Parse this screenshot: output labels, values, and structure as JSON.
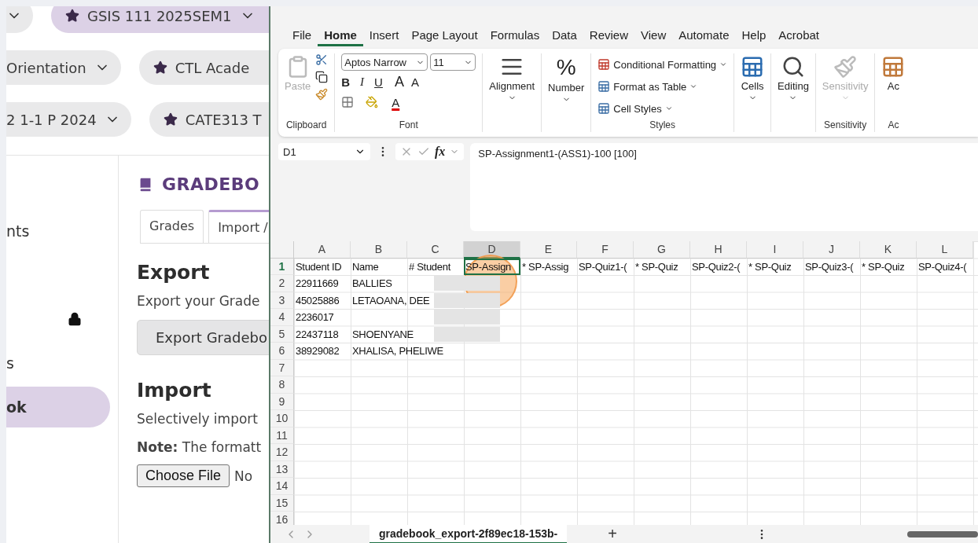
{
  "web_page": {
    "course_pills": [
      [
        {
          "starred": false,
          "selected": false,
          "chevron": true
        },
        {
          "label": "GSIS 111 2025SEM1",
          "starred": true,
          "selected": true,
          "chevron": true
        }
      ],
      [
        {
          "label": "Orientation",
          "starred": false,
          "selected": false,
          "chevron": true
        },
        {
          "label": "CTL Acade",
          "starred": true,
          "selected": false,
          "chevron": false
        }
      ],
      [
        {
          "label": "2 1-1 P 2024",
          "starred": false,
          "selected": false,
          "chevron": true
        },
        {
          "label": "CATE313 T",
          "starred": true,
          "selected": false,
          "chevron": false
        }
      ]
    ],
    "sidebar": {
      "items": [
        {
          "label": "nts",
          "locked": false,
          "selected": false
        },
        {
          "locked": true,
          "selected": false
        },
        {
          "label": "s",
          "locked": false,
          "selected": false
        },
        {
          "label": "ok",
          "locked": false,
          "selected": true
        }
      ]
    },
    "title": "GRADEBO",
    "tabs": [
      {
        "label": "Grades",
        "selected": false
      },
      {
        "label": "Import /",
        "selected": true
      }
    ],
    "export": {
      "heading": "Export",
      "text": "Export your Grade",
      "button": "Export Gradebo"
    },
    "import": {
      "heading": "Import",
      "text": "Selectively import",
      "note": "**Note:** The formatt",
      "file_button": "Choose File",
      "file_status": "No"
    }
  },
  "excel": {
    "menu": [
      {
        "label": "File",
        "selected": false
      },
      {
        "label": "Home",
        "selected": true
      },
      {
        "label": "Insert",
        "selected": false
      },
      {
        "label": "Page Layout",
        "selected": false
      },
      {
        "label": "Formulas",
        "selected": false
      },
      {
        "label": "Data",
        "selected": false
      },
      {
        "label": "Review",
        "selected": false
      },
      {
        "label": "View",
        "selected": false
      },
      {
        "label": "Automate",
        "selected": false
      },
      {
        "label": "Help",
        "selected": false
      },
      {
        "label": "Acrobat",
        "selected": false
      }
    ],
    "ribbon": {
      "clipboard": {
        "label": "Clipboard",
        "paste": "Paste",
        "paste_disabled": true
      },
      "font": {
        "label": "Font",
        "name": "Aptos Narrow",
        "size": "11",
        "bold": "B",
        "italic": "I",
        "underline": "U",
        "grow": "A",
        "shrink": "A",
        "color_letter": "A"
      },
      "alignment": "Alignment",
      "number": {
        "label": "Number",
        "symbol": "%"
      },
      "styles": {
        "label": "Styles",
        "items": [
          "Conditional Formatting",
          "Format as Table",
          "Cell Styles"
        ]
      },
      "cells": "Cells",
      "editing": "Editing",
      "sensitivity": {
        "button": "Sensitivity",
        "label": "Sensitivity",
        "disabled": true
      },
      "addins": {
        "button": "Ac",
        "label": "Ac"
      }
    },
    "formula_bar": {
      "name_box": "D1",
      "fx": "fx",
      "formula": "SP-Assignment1-(ASS1)-100 [100]"
    },
    "columns": [
      {
        "letter": "A",
        "selected": false
      },
      {
        "letter": "B",
        "selected": false
      },
      {
        "letter": "C",
        "selected": false
      },
      {
        "letter": "D",
        "selected": true
      },
      {
        "letter": "E",
        "selected": false
      },
      {
        "letter": "F",
        "selected": false
      },
      {
        "letter": "G",
        "selected": false
      },
      {
        "letter": "H",
        "selected": false
      },
      {
        "letter": "I",
        "selected": false
      },
      {
        "letter": "J",
        "selected": false
      },
      {
        "letter": "K",
        "selected": false
      },
      {
        "letter": "L",
        "selected": false
      }
    ],
    "rows": [
      {
        "number": "1",
        "selected": true,
        "cells": [
          "Student ID",
          "Name",
          "# Student",
          "SP-Assign",
          "* SP-Assig",
          "SP-Quiz1-(",
          "* SP-Quiz",
          "SP-Quiz2-(",
          "* SP-Quiz",
          "SP-Quiz3-(",
          "* SP-Quiz",
          "SP-Quiz4-("
        ]
      },
      {
        "number": "2",
        "selected": false,
        "redacted": true,
        "cells": [
          "22911669",
          "BALLIES"
        ]
      },
      {
        "number": "3",
        "selected": false,
        "redacted": true,
        "cells": [
          "45025886",
          "LETAOANA, DEE"
        ]
      },
      {
        "number": "4",
        "selected": false,
        "redacted": true,
        "cells": [
          "2236017"
        ]
      },
      {
        "number": "5",
        "selected": false,
        "redacted": true,
        "cells": [
          "22437118",
          "SHOENYANE"
        ]
      },
      {
        "number": "6",
        "selected": false,
        "cells": [
          "38929082",
          "XHALISA, PHELIWE"
        ]
      },
      {
        "number": "7",
        "selected": false
      },
      {
        "number": "8",
        "selected": false
      },
      {
        "number": "9",
        "selected": false
      },
      {
        "number": "10",
        "selected": false
      },
      {
        "number": "11",
        "selected": false
      },
      {
        "number": "12",
        "selected": false
      },
      {
        "number": "13",
        "selected": false
      },
      {
        "number": "14",
        "selected": false
      },
      {
        "number": "15",
        "selected": false
      },
      {
        "number": "16",
        "selected": false
      }
    ],
    "sheet_tab": "gradebook_export-2f89ec18-153b-",
    "add_sheet": "+"
  }
}
